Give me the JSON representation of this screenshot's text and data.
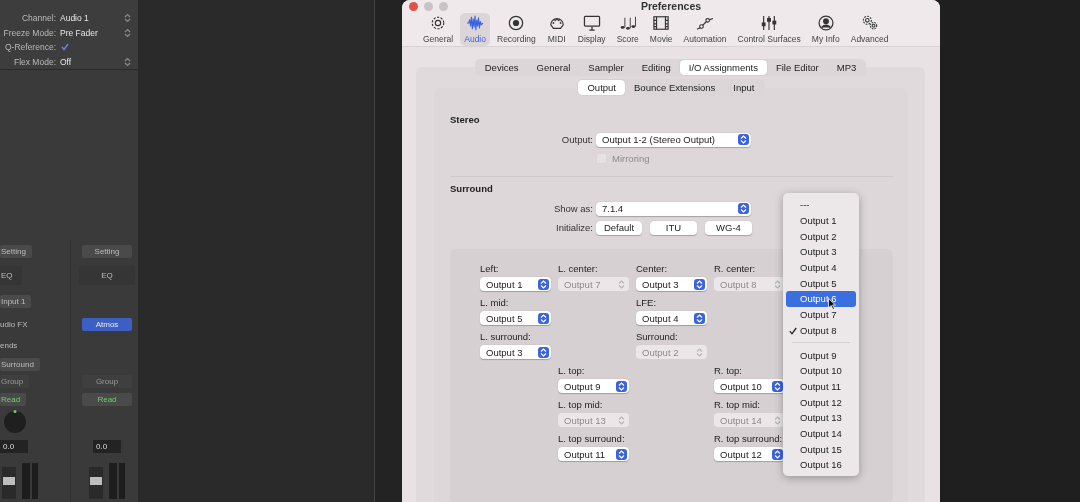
{
  "inspector": {
    "rows": [
      {
        "label": "Channel:",
        "value": "Audio 1",
        "kind": "popup"
      },
      {
        "label": "Freeze Mode:",
        "value": "Pre Fader",
        "kind": "popup"
      },
      {
        "label": "Q-Reference:",
        "checked": true,
        "kind": "checkbox"
      },
      {
        "label": "Flex Mode:",
        "value": "Off",
        "kind": "popup"
      }
    ]
  },
  "strips": [
    {
      "slots": [
        {
          "kind": "setting",
          "text": "Setting"
        },
        {
          "kind": "eq",
          "text": "EQ"
        },
        {
          "kind": "input",
          "text": "Input 1"
        },
        {
          "kind": "fx",
          "text": "udio FX"
        },
        {
          "kind": "sends",
          "text": "ends"
        },
        {
          "kind": "surround",
          "text": "Surround"
        },
        {
          "kind": "group",
          "text": "Group"
        },
        {
          "kind": "automation",
          "text": "Read"
        },
        {
          "kind": "pan"
        },
        {
          "kind": "volume",
          "text": "0.0"
        },
        {
          "kind": "fader"
        }
      ]
    },
    {
      "slots": [
        {
          "kind": "setting",
          "text": "Setting"
        },
        {
          "kind": "eq",
          "text": "EQ"
        },
        {
          "kind": "fx",
          "text": "Atmos",
          "active": true
        },
        {
          "kind": "group",
          "text": "Group"
        },
        {
          "kind": "automation",
          "text": "Read"
        },
        {
          "kind": "volume",
          "text": "0.0"
        },
        {
          "kind": "fader"
        }
      ]
    }
  ],
  "window": {
    "title": "Preferences"
  },
  "toolbar": [
    {
      "label": "General",
      "selected": false
    },
    {
      "label": "Audio",
      "selected": true
    },
    {
      "label": "Recording",
      "selected": false
    },
    {
      "label": "MIDI",
      "selected": false
    },
    {
      "label": "Display",
      "selected": false
    },
    {
      "label": "Score",
      "selected": false
    },
    {
      "label": "Movie",
      "selected": false
    },
    {
      "label": "Automation",
      "selected": false
    },
    {
      "label": "Control Surfaces",
      "selected": false
    },
    {
      "label": "My Info",
      "selected": false
    },
    {
      "label": "Advanced",
      "selected": false
    }
  ],
  "tabs": [
    {
      "label": "Devices",
      "selected": false
    },
    {
      "label": "General",
      "selected": false
    },
    {
      "label": "Sampler",
      "selected": false
    },
    {
      "label": "Editing",
      "selected": false
    },
    {
      "label": "I/O Assignments",
      "selected": true
    },
    {
      "label": "File Editor",
      "selected": false
    },
    {
      "label": "MP3",
      "selected": false
    }
  ],
  "subtabs": [
    {
      "label": "Output",
      "selected": true
    },
    {
      "label": "Bounce Extensions",
      "selected": false
    },
    {
      "label": "Input",
      "selected": false
    }
  ],
  "stereo": {
    "heading": "Stereo",
    "output_label": "Output:",
    "output": "Output 1-2 (Stereo Output)",
    "mirroring": {
      "label": "Mirroring",
      "checked": false,
      "disabled": true
    }
  },
  "surround": {
    "heading": "Surround",
    "show_as_label": "Show as:",
    "show_as": "7.1.4",
    "initialize_label": "Initialize:",
    "initialize_buttons": [
      "Default",
      "ITU",
      "WG-4"
    ],
    "speaker_rows": [
      [
        {
          "label": "Left:",
          "value": "Output 1",
          "disabled": false
        },
        {
          "label": "L. center:",
          "value": "Output 7",
          "disabled": true
        },
        {
          "label": "Center:",
          "value": "Output 3",
          "disabled": false
        },
        {
          "label": "R. center:",
          "value": "Output 8",
          "disabled": true
        }
      ],
      [
        {
          "label": "L. mid:",
          "value": "Output 5",
          "disabled": false
        },
        null,
        {
          "label": "LFE:",
          "value": "Output 4",
          "disabled": false
        },
        null
      ],
      [
        {
          "label": "L. surround:",
          "value": "Output 3",
          "disabled": false
        },
        null,
        {
          "label": "Surround:",
          "value": "Output 2",
          "disabled": true
        },
        null
      ],
      [
        null,
        {
          "label": "L. top:",
          "value": "Output 9",
          "disabled": false
        },
        null,
        {
          "label": "R. top:",
          "value": "Output 10",
          "disabled": false
        }
      ],
      [
        null,
        {
          "label": "L. top mid:",
          "value": "Output 13",
          "disabled": true
        },
        null,
        {
          "label": "R. top mid:",
          "value": "Output 14",
          "disabled": true
        }
      ],
      [
        null,
        {
          "label": "L. top surround:",
          "value": "Output 11",
          "disabled": false
        },
        null,
        {
          "label": "R. top surround:",
          "value": "Output 12",
          "disabled": false
        }
      ]
    ]
  },
  "menu": {
    "groups": [
      [
        {
          "label": "---",
          "selected": false,
          "checked": false
        },
        {
          "label": "Output 1",
          "selected": false,
          "checked": false
        },
        {
          "label": "Output 2",
          "selected": false,
          "checked": false
        },
        {
          "label": "Output 3",
          "selected": false,
          "checked": false
        },
        {
          "label": "Output 4",
          "selected": false,
          "checked": false
        },
        {
          "label": "Output 5",
          "selected": false,
          "checked": false
        },
        {
          "label": "Output 6",
          "selected": true,
          "checked": false
        },
        {
          "label": "Output 7",
          "selected": false,
          "checked": false
        },
        {
          "label": "Output 8",
          "selected": false,
          "checked": true
        }
      ],
      [
        {
          "label": "Output 9",
          "selected": false,
          "checked": false
        },
        {
          "label": "Output 10",
          "selected": false,
          "checked": false
        },
        {
          "label": "Output 11",
          "selected": false,
          "checked": false
        },
        {
          "label": "Output 12",
          "selected": false,
          "checked": false
        },
        {
          "label": "Output 13",
          "selected": false,
          "checked": false
        },
        {
          "label": "Output 14",
          "selected": false,
          "checked": false
        },
        {
          "label": "Output 15",
          "selected": false,
          "checked": false
        },
        {
          "label": "Output 16",
          "selected": false,
          "checked": false
        }
      ]
    ]
  }
}
